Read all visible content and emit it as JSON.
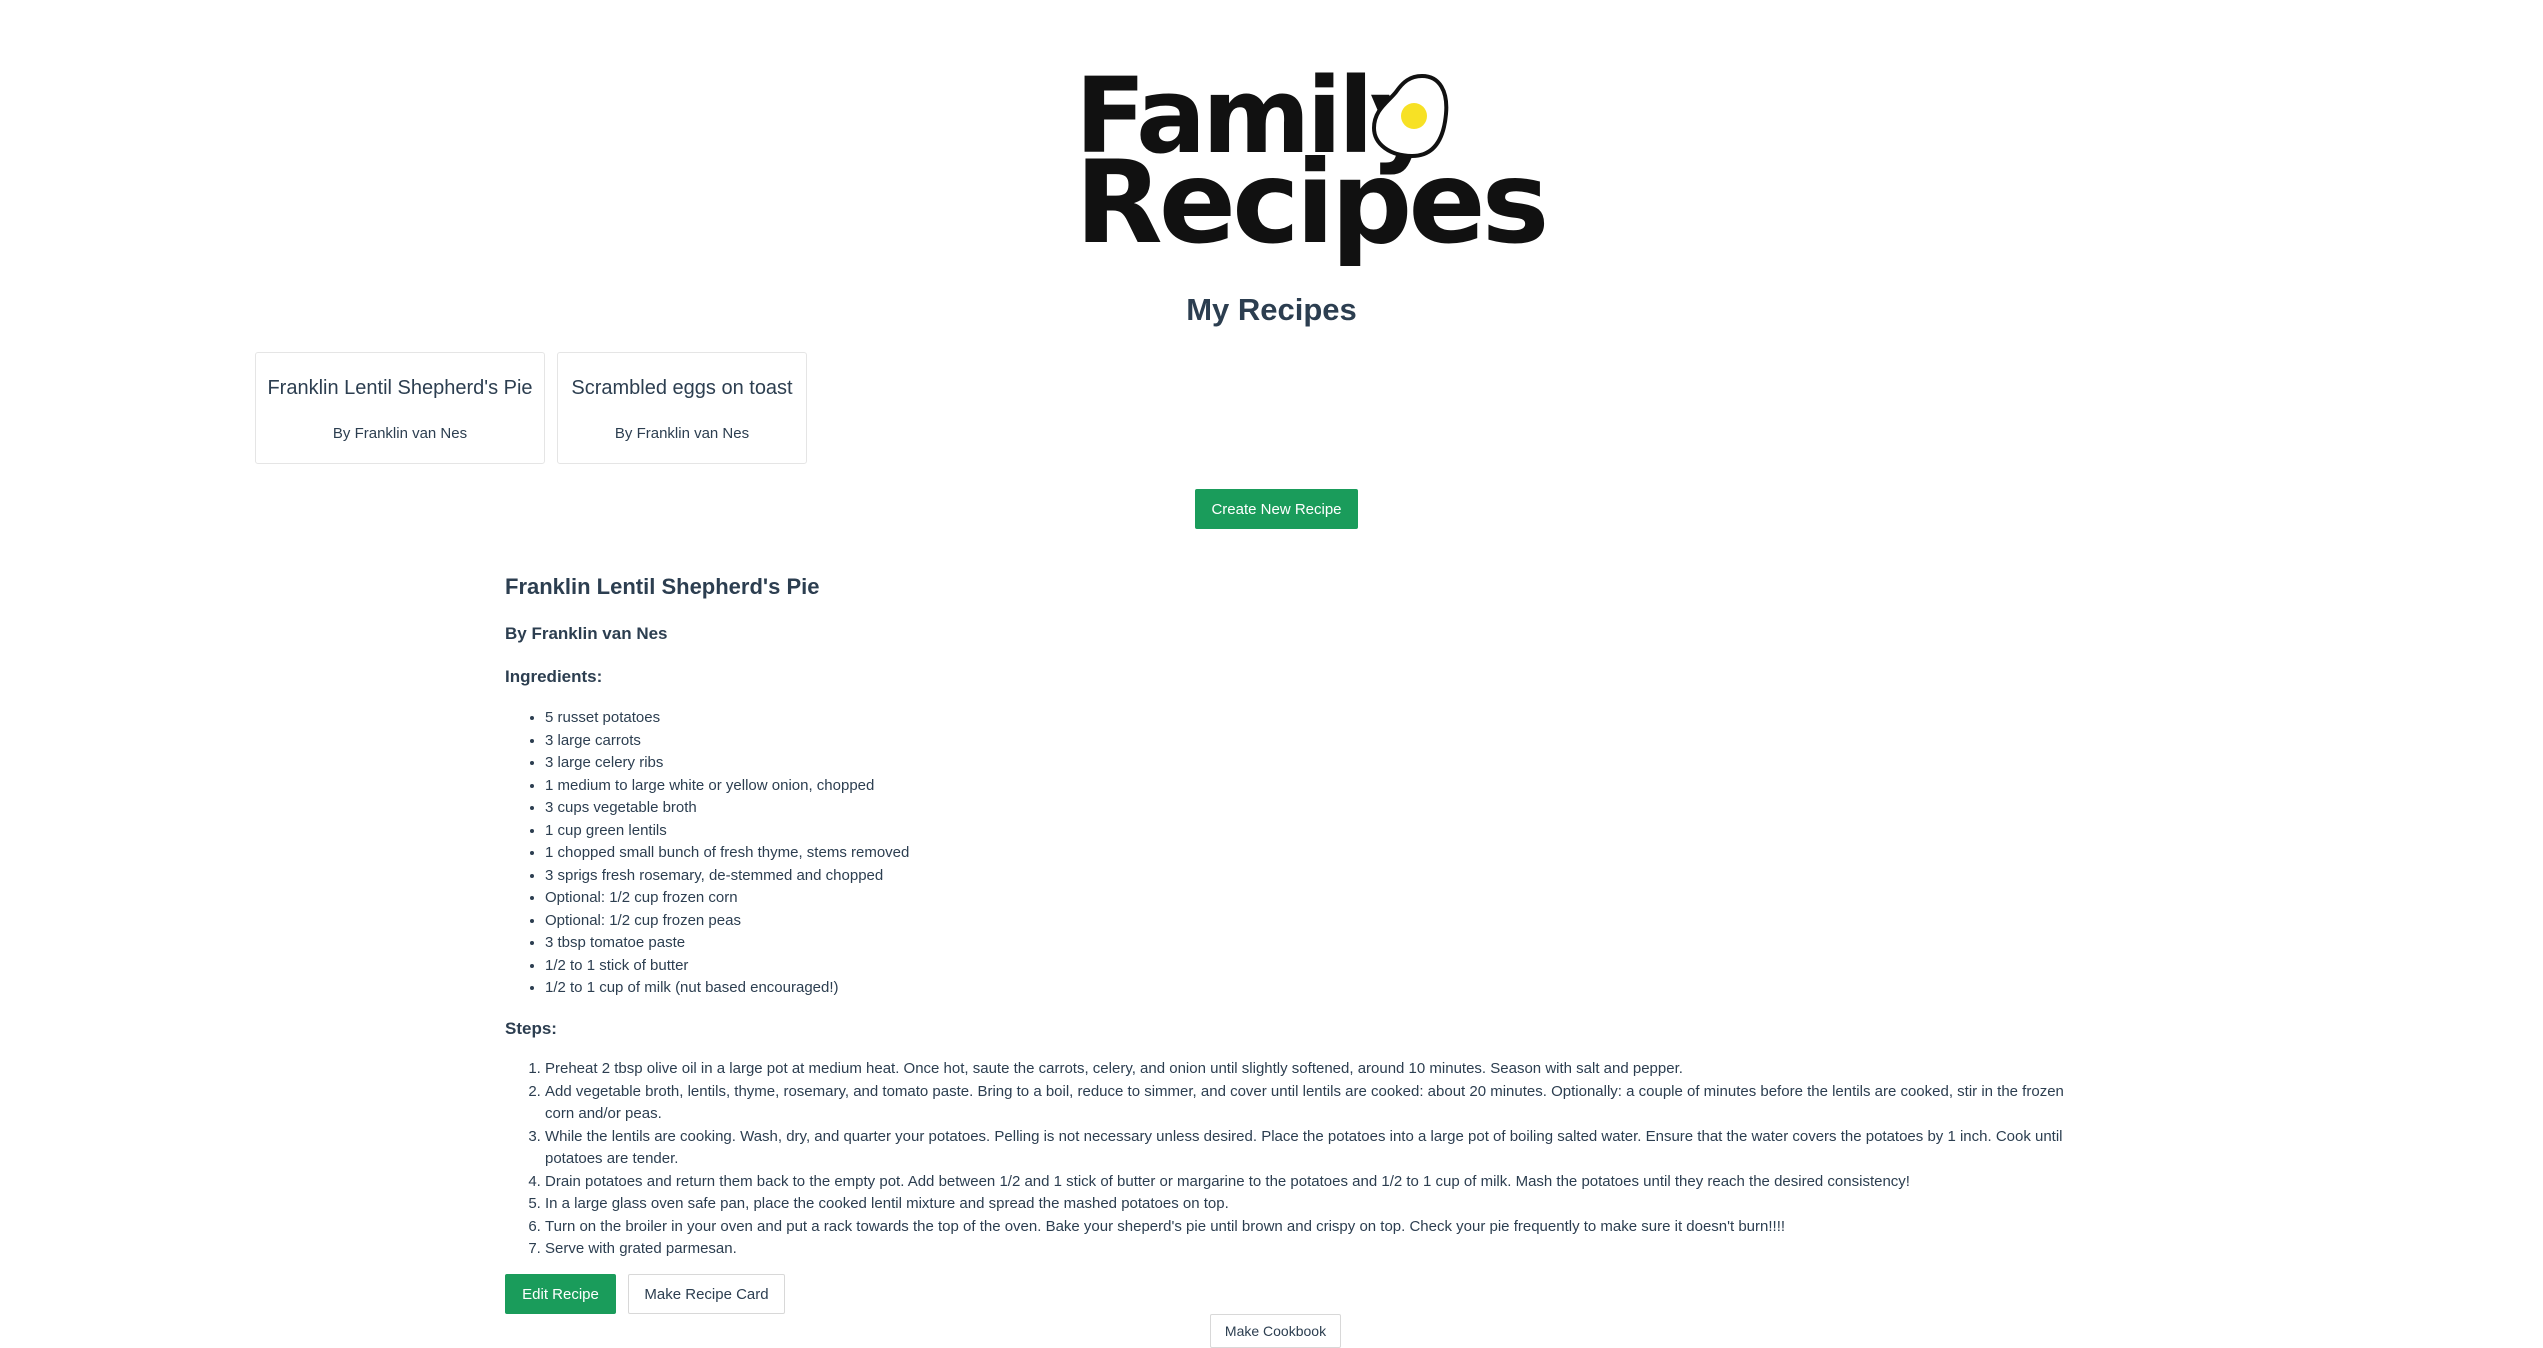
{
  "logo": {
    "line1": "Family",
    "line2": "Recipes"
  },
  "page_title": "My Recipes",
  "recipe_cards": [
    {
      "title": "Franklin Lentil Shepherd's Pie",
      "author": "By Franklin van Nes"
    },
    {
      "title": "Scrambled eggs on toast",
      "author": "By Franklin van Nes"
    }
  ],
  "create_button": "Create New Recipe",
  "detail": {
    "title": "Franklin Lentil Shepherd's Pie",
    "author": "By Franklin van Nes",
    "ingredients_label": "Ingredients:",
    "ingredients": [
      "5 russet potatoes",
      "3 large carrots",
      "3 large celery ribs",
      "1 medium to large white or yellow onion, chopped",
      "3 cups vegetable broth",
      "1 cup green lentils",
      "1 chopped small bunch of fresh thyme, stems removed",
      "3 sprigs fresh rosemary, de-stemmed and chopped",
      "Optional: 1/2 cup frozen corn",
      "Optional: 1/2 cup frozen peas",
      "3 tbsp tomatoe paste",
      "1/2 to 1 stick of butter",
      "1/2 to 1 cup of milk (nut based encouraged!)"
    ],
    "steps_label": "Steps:",
    "steps": [
      "Preheat 2 tbsp olive oil in a large pot at medium heat. Once hot, saute the carrots, celery, and onion until slightly softened, around 10 minutes. Season with salt and pepper.",
      "Add vegetable broth, lentils, thyme, rosemary, and tomato paste. Bring to a boil, reduce to simmer, and cover until lentils are cooked: about 20 minutes. Optionally: a couple of minutes before the lentils are cooked, stir in the frozen corn and/or peas.",
      "While the lentils are cooking. Wash, dry, and quarter your potatoes. Pelling is not necessary unless desired. Place the potatoes into a large pot of boiling salted water. Ensure that the water covers the potatoes by 1 inch. Cook until potatoes are tender.",
      "Drain potatoes and return them back to the empty pot. Add between 1/2 and 1 stick of butter or margarine to the potatoes and 1/2 to 1 cup of milk. Mash the potatoes until they reach the desired consistency!",
      "In a large glass oven safe pan, place the cooked lentil mixture and spread the mashed potatoes on top.",
      "Turn on the broiler in your oven and put a rack towards the top of the oven. Bake your sheperd's pie until brown and crispy on top. Check your pie frequently to make sure it doesn't burn!!!!",
      "Serve with grated parmesan."
    ],
    "edit_button": "Edit Recipe",
    "recipe_card_button": "Make Recipe Card"
  },
  "cookbook_button": "Make Cookbook",
  "colors": {
    "accent": "#1a9c5b",
    "text": "#2c3e50",
    "yolk": "#f7e125"
  },
  "icons": {
    "logo_egg": "fried-egg-icon"
  }
}
